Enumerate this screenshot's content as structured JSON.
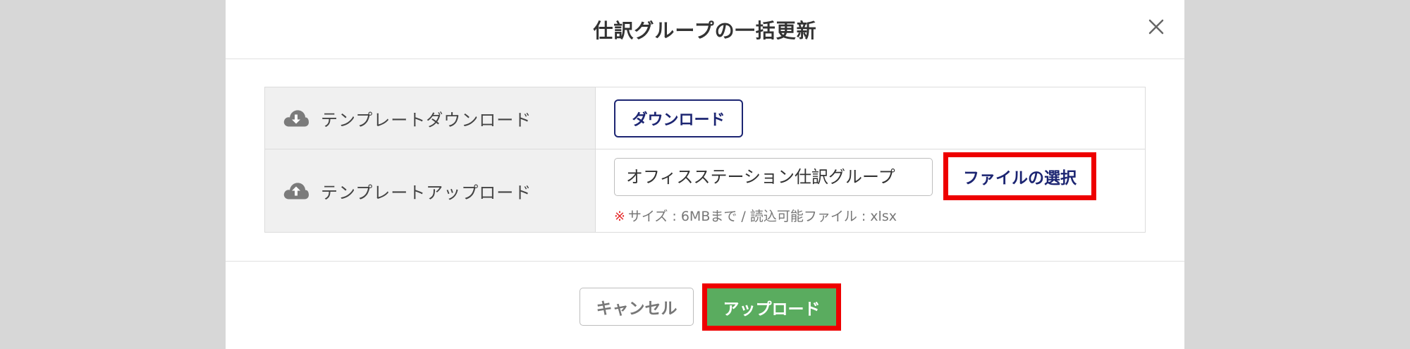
{
  "dialog": {
    "title": "仕訳グループの一括更新",
    "close_icon": "close-icon"
  },
  "rows": {
    "download": {
      "label": "テンプレートダウンロード",
      "icon": "cloud-download-icon",
      "button_label": "ダウンロード"
    },
    "upload": {
      "label": "テンプレートアップロード",
      "icon": "cloud-upload-icon",
      "file_name": "オフィスステーション仕訳グループ",
      "select_button_label": "ファイルの選択",
      "note_mark": "※",
      "note_text": "サイズ : 6MBまで / 読込可能ファイル : xlsx"
    }
  },
  "footer": {
    "cancel_label": "キャンセル",
    "upload_label": "アップロード"
  },
  "colors": {
    "overlay": "#d7d7d7",
    "accent_navy": "#1c2572",
    "upload_green": "#5aac5f",
    "highlight_red": "#ee0000",
    "note_mark_red": "#e53030"
  }
}
